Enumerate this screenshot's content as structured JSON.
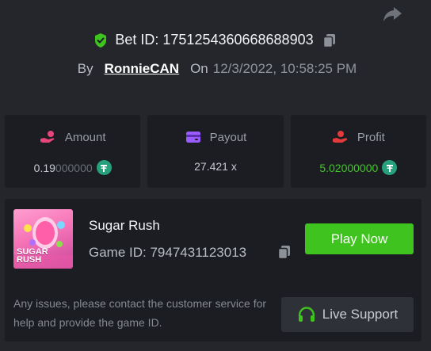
{
  "header": {
    "bet_id_label": "Bet ID: 1751254360668688903",
    "by_label": "By",
    "username": "RonnieCAN",
    "on_label": "On",
    "datetime": "12/3/2022, 10:58:25 PM",
    "share_icon": "share-icon",
    "verified_icon": "shield-check-icon",
    "copy_icon": "copy-icon"
  },
  "stats": {
    "amount": {
      "label": "Amount",
      "value_main": "0.19",
      "value_dim": "000000",
      "icon": "hand-coins-icon",
      "currency_icon": "usdt-icon"
    },
    "payout": {
      "label": "Payout",
      "value": "27.421 x",
      "icon": "wallet-icon"
    },
    "profit": {
      "label": "Profit",
      "value_main": "5.02",
      "value_dim": "000000",
      "icon": "profit-hand-icon",
      "currency_icon": "usdt-icon"
    }
  },
  "game": {
    "title": "Sugar Rush",
    "id_label": "Game ID: 7947431123013",
    "thumb_text_1": "SUGAR",
    "thumb_text_2": "RUSH",
    "play_label": "Play Now",
    "issue_text": "Any issues, please contact the customer service for help and provide the game ID.",
    "support_label": "Live Support",
    "support_icon": "headset-icon"
  },
  "colors": {
    "background": "#24262b",
    "panel": "#1b1d22",
    "accent_green": "#3fc31e",
    "profit_green": "#42c52a",
    "amount_icon": "#e8457a",
    "payout_icon": "#9b5cff",
    "profit_icon": "#e33b3b",
    "usdt": "#26a17b"
  }
}
